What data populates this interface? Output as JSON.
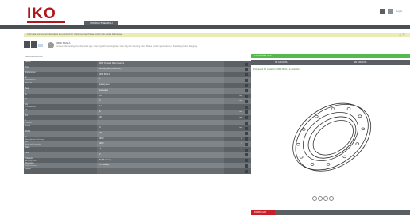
{
  "header": {
    "logo_text": "IKO",
    "nav_tab_label": "PRODUCT SEARCH",
    "user_label": "Login"
  },
  "notice": {
    "text": "CAD data and product information are provided for reference only. Please confirm the details before use."
  },
  "product": {
    "code": "CRBF 8022 A",
    "description": "Crossed roller bearing, mounting holes type, outer ring with mounting holes, inner ring with mounting holes. Please confirm specifications in the catalog before designing."
  },
  "section_label": "SPECIFICATIONS",
  "spec_rows": [
    {
      "label": "Series",
      "sub": "",
      "value": "CRBF (Crossed Roller Bearing)",
      "unit": ""
    },
    {
      "label": "Type",
      "sub": "",
      "value": "Mounting holes (CRBF...AT)",
      "unit": ""
    },
    {
      "label": "Part number",
      "sub": "",
      "value": "CRBF 8022 A",
      "unit": ""
    },
    {
      "label": "d",
      "sub": "Bore diameter",
      "value": "80",
      "unit": "mm"
    },
    {
      "label": "Material",
      "sub": "",
      "value": "Bearing steel",
      "unit": ""
    },
    {
      "label": "Seal",
      "sub": "Seal type",
      "value": "Non-sealed",
      "unit": ""
    },
    {
      "label": "D",
      "sub": "",
      "value": "165",
      "unit": "mm"
    },
    {
      "label": "B",
      "sub": "",
      "value": "22",
      "unit": "mm"
    },
    {
      "label": "dm",
      "sub": "Pitch diameter",
      "value": "112",
      "unit": "mm"
    },
    {
      "label": "d1",
      "sub": "",
      "value": "96",
      "unit": "mm"
    },
    {
      "label": "D1",
      "sub": "",
      "value": "128",
      "unit": "mm"
    },
    {
      "label": "r",
      "sub": "Chamfer",
      "value": "1",
      "unit": "mm"
    },
    {
      "label": "PCD1",
      "sub": "",
      "value": "94",
      "unit": "mm"
    },
    {
      "label": "PCD2",
      "sub": "",
      "value": "145",
      "unit": "mm"
    },
    {
      "label": "C",
      "sub": "Basic dynamic load rating",
      "value": "18800",
      "unit": "N"
    },
    {
      "label": "C0",
      "sub": "Basic static load rating",
      "value": "24800",
      "unit": "N"
    },
    {
      "label": "Mass",
      "sub": "",
      "value": "1.9",
      "unit": "kg"
    },
    {
      "label": "Hole",
      "sub": "",
      "value": "12",
      "unit": ""
    },
    {
      "label": "Tolerance",
      "sub": "Accuracy class",
      "value": "P5 (JIS class 5)",
      "unit": ""
    },
    {
      "label": "Clearance",
      "sub": "Radial clearance",
      "value": "C1 (Preload)",
      "unit": ""
    },
    {
      "label": "Option",
      "sub": "",
      "value": "",
      "unit": ""
    }
  ],
  "cad": {
    "header_label": "CAD DOWNLOAD",
    "tab_left": "3D CAD DATA",
    "tab_right": "2D CAD DATA",
    "status_text": "Preview of 3D model for CRBF 8022 A is available.",
    "red_bar_label": "DOWNLOAD"
  },
  "colors": {
    "brand": "#b0161c",
    "dark_gray": "#4b5054",
    "row_dark": "#5c6165",
    "row_light": "#767b80",
    "accent_green": "#55b94d",
    "accent_red": "#c8202a"
  }
}
